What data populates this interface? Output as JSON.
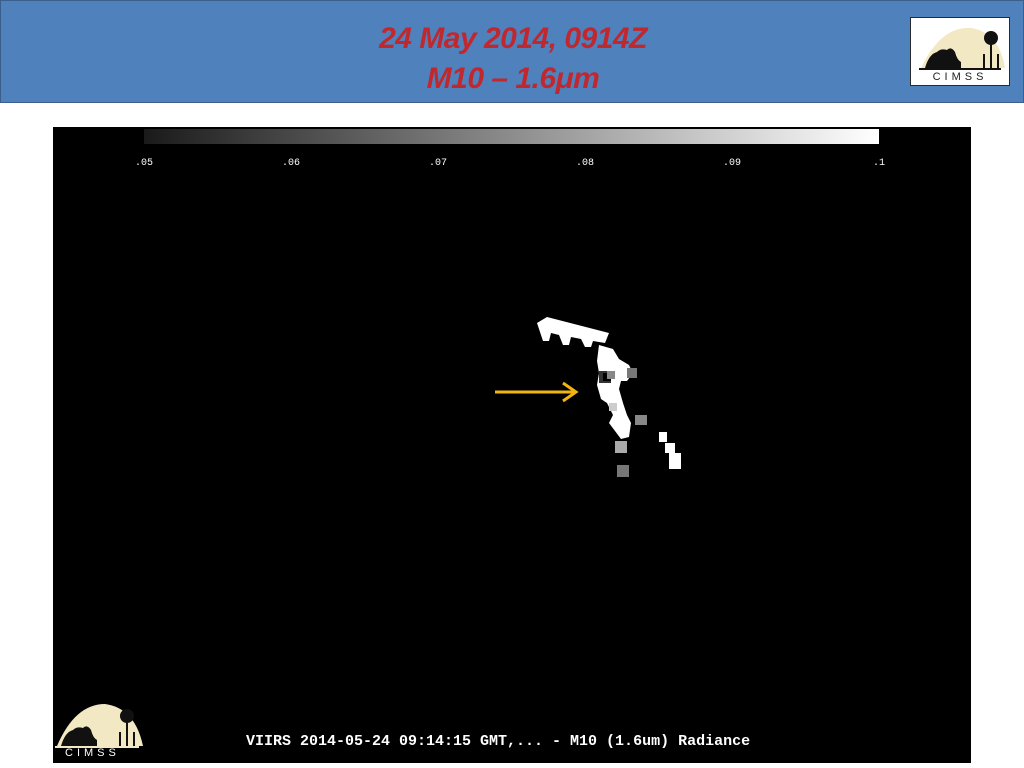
{
  "header": {
    "title_line1": "24 May 2014, 0914Z",
    "title_line2": "M10 – 1.6",
    "title_mu": "μ",
    "title_unit": "m",
    "title_color": "#c0282d",
    "background": "#4f81bd",
    "logo_text": "CIMSS"
  },
  "colorbar": {
    "ticks": [
      ".05",
      ".06",
      ".07",
      ".08",
      ".09",
      ".1"
    ],
    "min_color": "#1a1a1a",
    "max_color": "#ffffff"
  },
  "image": {
    "caption": "VIIRS 2014-05-24 09:14:15 GMT,... - M10 (1.6um) Radiance",
    "logo_text": "CIMSS",
    "arrow_color": "#f2b410"
  }
}
